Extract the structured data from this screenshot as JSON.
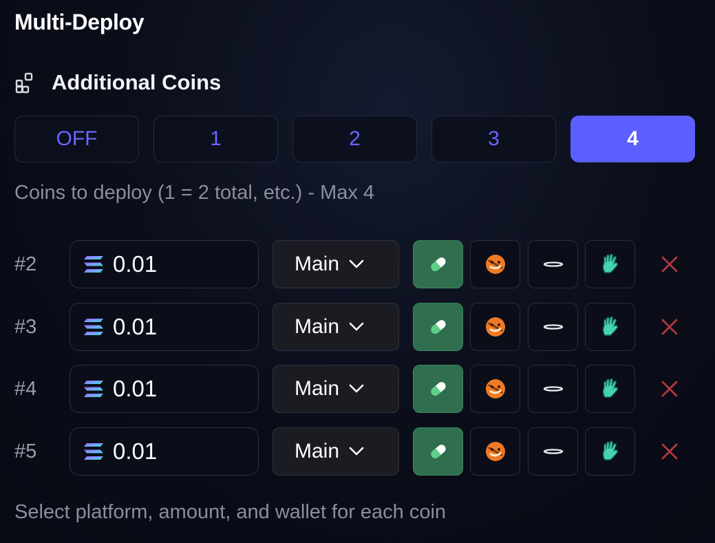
{
  "title": "Multi-Deploy",
  "section": {
    "label": "Additional Coins",
    "icon": "grid-plus-icon"
  },
  "count_options": [
    {
      "label": "OFF",
      "active": false
    },
    {
      "label": "1",
      "active": false
    },
    {
      "label": "2",
      "active": false
    },
    {
      "label": "3",
      "active": false
    },
    {
      "label": "4",
      "active": true
    }
  ],
  "hint": "Coins to deploy (1 = 2 total, etc.) - Max 4",
  "coins": [
    {
      "index": "#2",
      "amount": "0.01",
      "currency_icon": "solana-icon",
      "wallet": "Main",
      "selected_platform": "pill-icon"
    },
    {
      "index": "#3",
      "amount": "0.01",
      "currency_icon": "solana-icon",
      "wallet": "Main",
      "selected_platform": "pill-icon"
    },
    {
      "index": "#4",
      "amount": "0.01",
      "currency_icon": "solana-icon",
      "wallet": "Main",
      "selected_platform": "pill-icon"
    },
    {
      "index": "#5",
      "amount": "0.01",
      "currency_icon": "solana-icon",
      "wallet": "Main",
      "selected_platform": "pill-icon"
    }
  ],
  "platform_icons": [
    "pill-icon",
    "orange-mascot-icon",
    "halo-ring-icon",
    "green-hand-icon"
  ],
  "footer": "Select platform, amount, and wallet for each coin",
  "colors": {
    "accent": "#5b5fff",
    "accent_text": "#6b66ff",
    "selected_platform_bg": "#2f6e4f",
    "remove": "#b3383f",
    "muted_text": "#8b8f9c"
  }
}
